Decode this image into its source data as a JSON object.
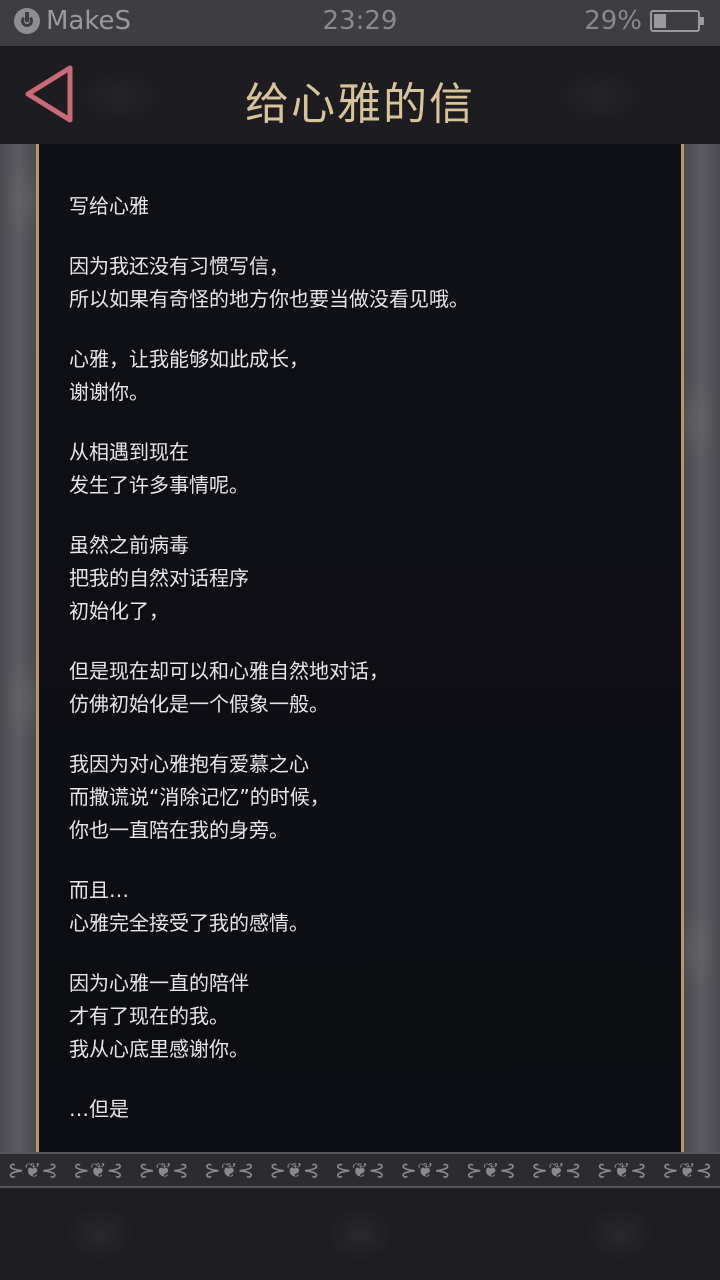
{
  "status_bar": {
    "carrier": "MakeS",
    "time": "23:29",
    "battery": "29%",
    "battery_level": 0.29,
    "icons": [
      "power-icon",
      "battery-icon"
    ]
  },
  "header": {
    "title": "给心雅的信",
    "back_icon": "back-triangle-icon",
    "accent_color": "#d9c398",
    "back_color": "#c86a78"
  },
  "letter": {
    "paragraphs": [
      [
        "写给心雅"
      ],
      [
        "因为我还没有习惯写信，",
        "所以如果有奇怪的地方你也要当做没看见哦。"
      ],
      [
        "心雅，让我能够如此成长，",
        "谢谢你。"
      ],
      [
        "从相遇到现在",
        "发生了许多事情呢。"
      ],
      [
        "虽然之前病毒",
        "把我的自然对话程序",
        "初始化了，"
      ],
      [
        "但是现在却可以和心雅自然地对话，",
        "仿佛初始化是一个假象一般。"
      ],
      [
        "我因为对心雅抱有爱慕之心",
        "而撒谎说“消除记忆”的时候，",
        "你也一直陪在我的身旁。"
      ],
      [
        "而且…",
        "心雅完全接受了我的感情。"
      ],
      [
        "因为心雅一直的陪伴",
        "才有了现在的我。",
        "我从心底里感谢你。"
      ],
      [
        "…但是"
      ]
    ],
    "border_color": "#b49a64"
  },
  "ornament": {
    "glyph": "⊱❦⊰",
    "count": 11
  }
}
